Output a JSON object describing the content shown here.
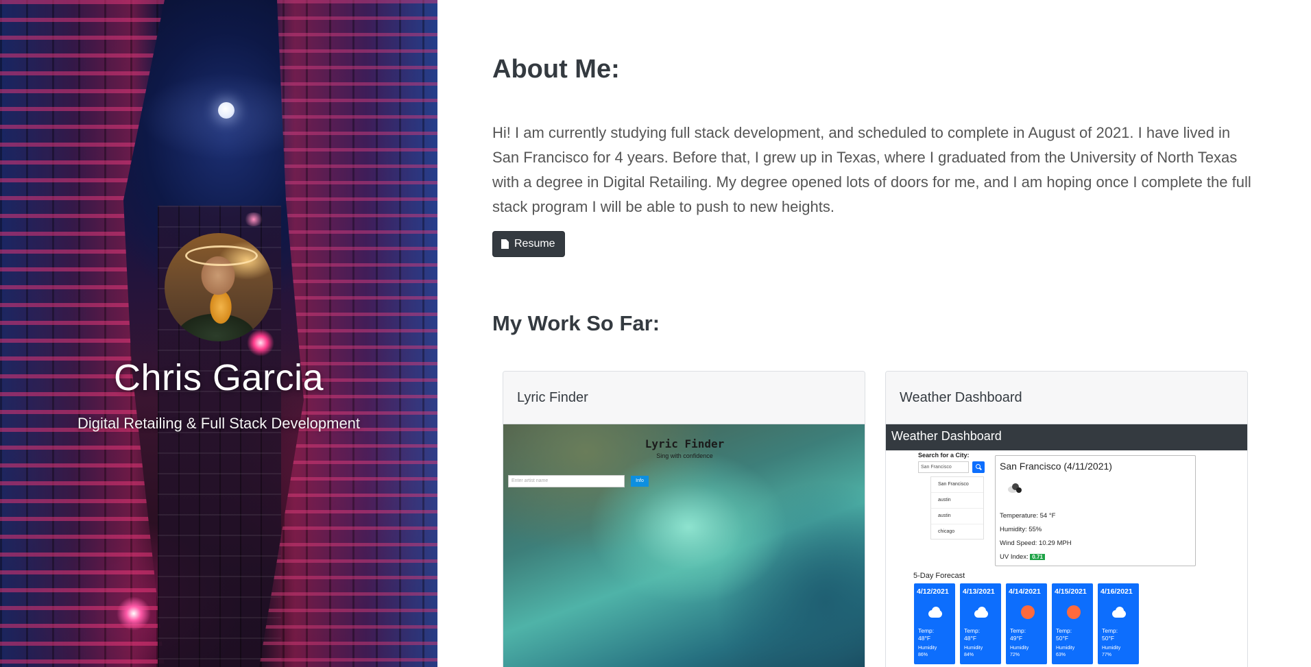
{
  "hero": {
    "name": "Chris Garcia",
    "subtitle": "Digital Retailing & Full Stack Development"
  },
  "about": {
    "heading": "About Me:",
    "text": "Hi! I am currently studying full stack development, and scheduled to complete in August of 2021. I have lived in San Francisco for 4 years. Before that, I grew up in Texas, where I graduated from the University of North Texas with a degree in Digital Retailing. My degree opened lots of doors for me, and I am hoping once I complete the full stack program I will be able to push to new heights.",
    "resume_label": "Resume",
    "resume_icon": "file-icon"
  },
  "work": {
    "heading": "My Work So Far:",
    "projects": [
      {
        "title": "Lyric Finder",
        "preview": {
          "app_title": "Lyric Finder",
          "app_subtitle": "Sing with confidence",
          "input_placeholder": "Enter artist name",
          "button_label": "Info"
        }
      },
      {
        "title": "Weather Dashboard",
        "preview": {
          "nav_title": "Weather Dashboard",
          "search_label": "Search for a City:",
          "search_value": "San Francisco",
          "history": [
            "San Francisco",
            "austin",
            "austin",
            "chicago"
          ],
          "today_title": "San Francisco (4/11/2021)",
          "temperature": "Temperature: 54 °F",
          "humidity": "Humidity: 55%",
          "wind": "Wind Speed: 10.29 MPH",
          "uv_label": "UV Index:",
          "uv_value": "0.71",
          "forecast_label": "5-Day Forecast",
          "forecast": [
            {
              "date": "4/12/2021",
              "icon": "cloud-icon",
              "temp_label": "Temp:",
              "temp": "48°F",
              "humidity_label": "Humidity",
              "humidity": "86%"
            },
            {
              "date": "4/13/2021",
              "icon": "cloud-icon",
              "temp_label": "Temp:",
              "temp": "48°F",
              "humidity_label": "Humidity",
              "humidity": "84%"
            },
            {
              "date": "4/14/2021",
              "icon": "sun-icon",
              "temp_label": "Temp:",
              "temp": "49°F",
              "humidity_label": "Humidity",
              "humidity": "72%"
            },
            {
              "date": "4/15/2021",
              "icon": "sun-icon",
              "temp_label": "Temp:",
              "temp": "50°F",
              "humidity_label": "Humidity",
              "humidity": "63%"
            },
            {
              "date": "4/16/2021",
              "icon": "cloud-icon",
              "temp_label": "Temp:",
              "temp": "50°F",
              "humidity_label": "Humidity",
              "humidity": "77%"
            }
          ]
        }
      }
    ]
  },
  "colors": {
    "dark_button": "#343a40",
    "weather_blue": "#0d6efd",
    "uv_green": "#1fa347"
  }
}
